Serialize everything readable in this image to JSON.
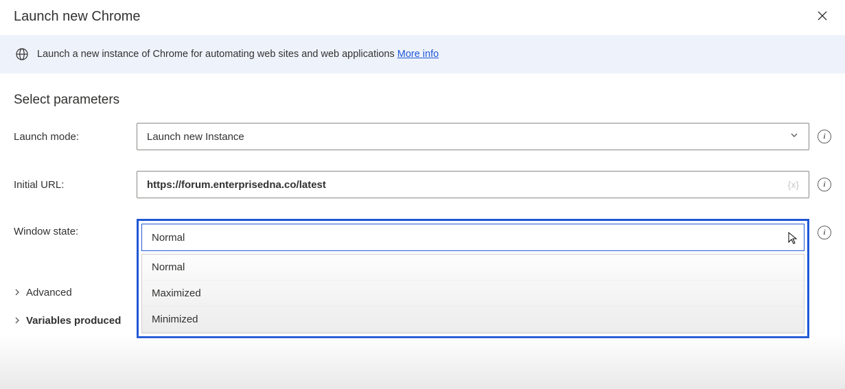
{
  "header": {
    "title": "Launch new Chrome"
  },
  "banner": {
    "text": "Launch a new instance of Chrome for automating web sites and web applications ",
    "link_label": "More info"
  },
  "section_title": "Select parameters",
  "fields": {
    "launch_mode": {
      "label": "Launch mode:",
      "value": "Launch new Instance"
    },
    "initial_url": {
      "label": "Initial URL:",
      "value": "https://forum.enterprisedna.co/latest",
      "var_hint": "{x}"
    },
    "window_state": {
      "label": "Window state:",
      "selected": "Normal",
      "options": [
        "Normal",
        "Maximized",
        "Minimized"
      ]
    }
  },
  "expanders": {
    "advanced": "Advanced",
    "variables": "Variables produced"
  }
}
